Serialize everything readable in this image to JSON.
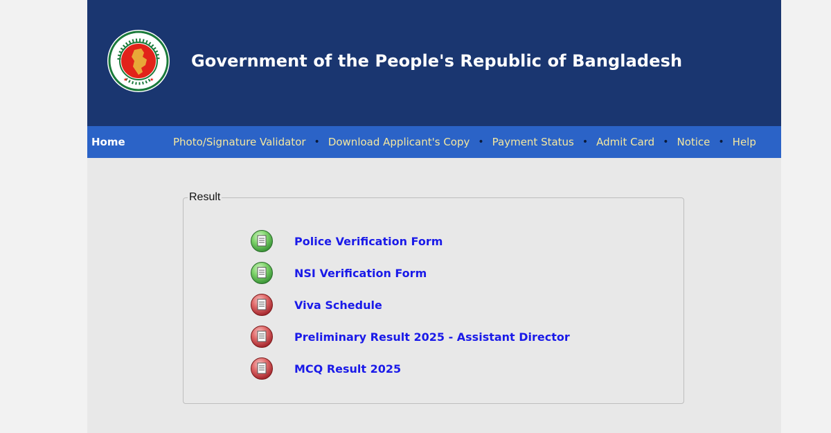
{
  "header": {
    "title": "Government of the People's Republic of Bangladesh",
    "logo": {
      "icon": "bangladesh-government-seal-icon",
      "colors": {
        "ring_green": "#1a7a3a",
        "disc_red": "#e2231a",
        "map_gold": "#e8a838"
      }
    }
  },
  "nav": {
    "home": "Home",
    "items": [
      {
        "label": "Photo/Signature Validator"
      },
      {
        "label": "Download Applicant's Copy"
      },
      {
        "label": "Payment Status"
      },
      {
        "label": "Admit Card"
      },
      {
        "label": "Notice"
      },
      {
        "label": "Help"
      }
    ],
    "separator": "•"
  },
  "result": {
    "legend": "Result",
    "items": [
      {
        "label": "Police Verification Form",
        "icon": "document-green-icon",
        "icon_color": "#3aa845"
      },
      {
        "label": "NSI Verification Form",
        "icon": "document-green-icon",
        "icon_color": "#3aa845"
      },
      {
        "label": "Viva Schedule",
        "icon": "document-red-icon",
        "icon_color": "#b8202a"
      },
      {
        "label": "Preliminary Result 2025 - Assistant Director",
        "icon": "document-red-icon",
        "icon_color": "#b8202a"
      },
      {
        "label": "MCQ Result 2025",
        "icon": "document-red-icon",
        "icon_color": "#b8202a"
      }
    ]
  },
  "colors": {
    "header_bg": "#1a3670",
    "nav_bg": "#2b63c7",
    "nav_link": "#f4e8a0",
    "result_link": "#1a1ae8",
    "page_bg": "#e8e8e8"
  }
}
